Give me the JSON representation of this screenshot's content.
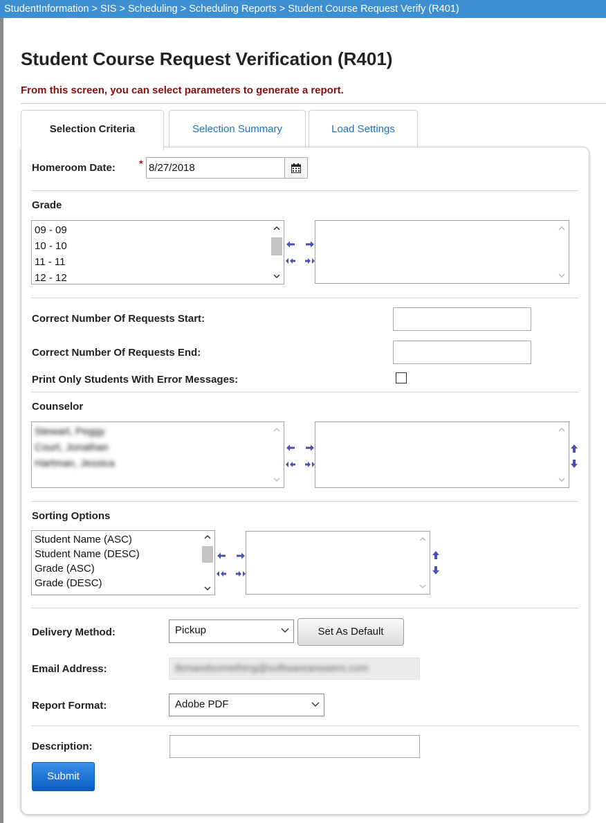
{
  "breadcrumb": "StudentInformation > SIS > Scheduling > Scheduling Reports > Student Course Request Verify (R401)",
  "title": "Student Course Request Verification (R401)",
  "subtitle": "From this screen, you can select parameters to generate a report.",
  "tabs": [
    {
      "label": "Selection Criteria",
      "active": true
    },
    {
      "label": "Selection Summary",
      "active": false
    },
    {
      "label": "Load Settings",
      "active": false
    }
  ],
  "homeroom": {
    "label": "Homeroom Date:",
    "required_mark": "*",
    "value": "8/27/2018"
  },
  "grade": {
    "label": "Grade",
    "options": [
      "09 - 09",
      "10 - 10",
      "11 - 11",
      "12 - 12"
    ]
  },
  "requests_start": {
    "label": "Correct Number Of Requests Start:",
    "value": ""
  },
  "requests_end": {
    "label": "Correct Number Of Requests End:",
    "value": ""
  },
  "print_errors": {
    "label": "Print Only Students With Error Messages:",
    "checked": false
  },
  "counselor": {
    "label": "Counselor",
    "options": [
      "Stewart, Peggy",
      "Court, Jonathan",
      "Hartman, Jessica"
    ]
  },
  "sorting": {
    "label": "Sorting Options",
    "options": [
      "Student Name (ASC)",
      "Student Name (DESC)",
      "Grade (ASC)",
      "Grade (DESC)"
    ]
  },
  "delivery": {
    "label": "Delivery Method:",
    "value": "Pickup",
    "default_button": "Set As Default"
  },
  "email": {
    "label": "Email Address:",
    "value": "tbmandsomething@softwareanswers.com"
  },
  "format": {
    "label": "Report Format:",
    "value": "Adobe PDF"
  },
  "description": {
    "label": "Description:",
    "value": ""
  },
  "submit": "Submit",
  "colors": {
    "breadcrumb_bg": "#3d8fd1",
    "subtitle": "#8b0d0d",
    "link": "#1a73c8",
    "submit_bg": "#0a5dc4",
    "arrow": "#4b4fb0"
  }
}
